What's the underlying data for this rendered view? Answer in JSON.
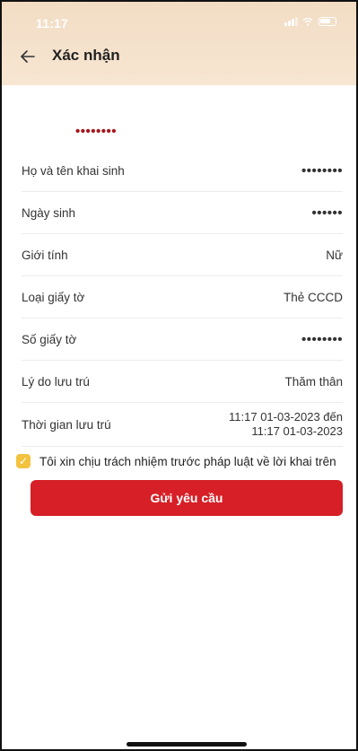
{
  "status_bar": {
    "time": "11:17"
  },
  "header": {
    "back_icon": "arrow-left-icon",
    "title": "Xác nhận"
  },
  "masked_name": "••••••••",
  "fields": [
    {
      "label": "Họ và tên khai sinh",
      "value": "••••••••",
      "masked": true
    },
    {
      "label": "Ngày sinh",
      "value": "••••••",
      "masked": true
    },
    {
      "label": "Giới tính",
      "value": "Nữ",
      "masked": false
    },
    {
      "label": "Loại giấy tờ",
      "value": "Thẻ CCCD",
      "masked": false
    },
    {
      "label": "Số giấy tờ",
      "value": "••••••••",
      "masked": true
    },
    {
      "label": "Lý do lưu trú",
      "value": "Thăm thân",
      "masked": false
    },
    {
      "label": "Thời gian lưu trú",
      "value_line1": "11:17 01-03-2023 đến",
      "value_line2": "11:17 01-03-2023",
      "masked": false
    }
  ],
  "consent": {
    "checked": true,
    "text": "Tôi xin chịu trách nhiệm trước pháp luật về lời khai trên"
  },
  "submit_label": "Gửi yêu cầu",
  "colors": {
    "accent_red": "#d61f26",
    "masked_red": "#a3161c",
    "checkbox_yellow": "#f3c23e",
    "header_bg": "#f2dcc4"
  }
}
